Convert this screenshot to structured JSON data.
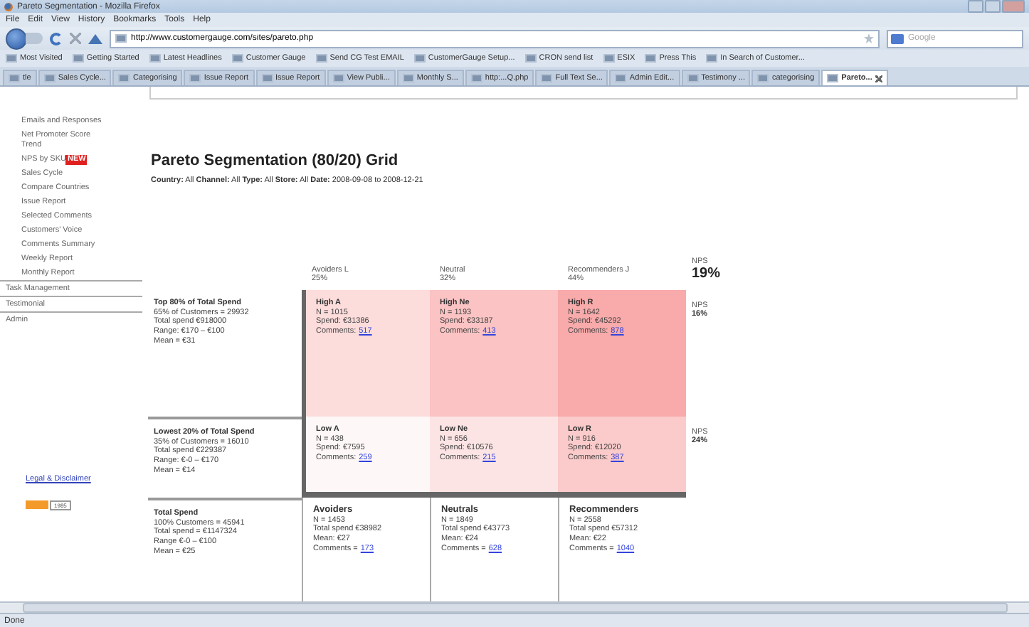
{
  "window": {
    "title": "Pareto Segmentation - Mozilla Firefox"
  },
  "menu": [
    "File",
    "Edit",
    "View",
    "History",
    "Bookmarks",
    "Tools",
    "Help"
  ],
  "address": {
    "value": "http://www.customergauge.com/sites/pareto.php"
  },
  "search": {
    "placeholder": "Google"
  },
  "bookmarks": [
    "Most Visited",
    "Getting Started",
    "Latest Headlines",
    "Customer Gauge",
    "Send CG Test EMAIL",
    "CustomerGauge Setup...",
    "CRON send list",
    "ESIX",
    "Press This",
    "In Search of Customer..."
  ],
  "tabs": [
    {
      "label": "tle",
      "selected": false
    },
    {
      "label": "Sales Cycle...",
      "selected": false
    },
    {
      "label": "Categorising",
      "selected": false
    },
    {
      "label": "Issue Report",
      "selected": false
    },
    {
      "label": "Issue Report",
      "selected": false
    },
    {
      "label": "View Publi...",
      "selected": false
    },
    {
      "label": "Monthly S...",
      "selected": false
    },
    {
      "label": "http:...Q.php",
      "selected": false
    },
    {
      "label": "Full Text Se...",
      "selected": false
    },
    {
      "label": "Admin Edit...",
      "selected": false
    },
    {
      "label": "Testimony ...",
      "selected": false
    },
    {
      "label": "categorising",
      "selected": false
    },
    {
      "label": "Pareto...",
      "selected": true
    }
  ],
  "sidebar": {
    "items": [
      {
        "label": "Emails and Responses",
        "kind": "sub"
      },
      {
        "label": "Net Promoter Score Trend",
        "kind": "sub"
      },
      {
        "label": "NPS by SKU",
        "badge": "NEW",
        "kind": "sub"
      },
      {
        "label": "Sales Cycle",
        "kind": "sub"
      },
      {
        "label": "Compare Countries",
        "kind": "sub"
      },
      {
        "label": "Issue Report",
        "kind": "sub"
      },
      {
        "label": "Selected Comments",
        "kind": "sub"
      },
      {
        "label": "Customers' Voice",
        "kind": "sub"
      },
      {
        "label": "Comments Summary",
        "kind": "sub"
      },
      {
        "label": "Weekly Report",
        "kind": "sub"
      },
      {
        "label": "Monthly Report",
        "kind": "sub"
      },
      {
        "label": "Task Management",
        "kind": "top"
      },
      {
        "label": "Testimonial",
        "kind": "top"
      },
      {
        "label": "Admin",
        "kind": "top"
      }
    ],
    "legal_link": "Legal & Disclaimer",
    "badge_text": "1985"
  },
  "page": {
    "title": "Pareto Segmentation (80/20) Grid",
    "filters": "**Country:** All **Channel:** All **Type:** All **Store:** All **Date:** 2008-09-08 to 2008-12-21"
  },
  "grid": {
    "columns": [
      {
        "label": "Avoiders L",
        "share": "25%"
      },
      {
        "label": "Neutral",
        "share": "32%"
      },
      {
        "label": "Recommenders J",
        "share": "44%"
      }
    ],
    "nps_total": {
      "label": "NPS",
      "value": "19%"
    },
    "rows": [
      {
        "segment": {
          "title": "Top 80% of Total Spend",
          "lines": [
            "65% of Customers = 29932",
            "Total spend €918000",
            "Range: €170 – €100",
            "Mean = €31"
          ]
        },
        "cells": [
          {
            "title": "High A",
            "lines": [
              "N = 1015",
              "Spend: €31386"
            ],
            "comments_label": "Comments:",
            "comments": "517",
            "color": "#fddcdc"
          },
          {
            "title": "High Ne",
            "lines": [
              "N = 1193",
              "Spend: €33187"
            ],
            "comments_label": "Comments:",
            "comments": "413",
            "color": "#fbc3c3"
          },
          {
            "title": "High R",
            "lines": [
              "N = 1642",
              "Spend: €45292"
            ],
            "comments_label": "Comments:",
            "comments": "878",
            "color": "#f9aaaa"
          }
        ],
        "nps": {
          "label": "NPS",
          "value": "16%"
        }
      },
      {
        "segment": {
          "title": "Lowest 20% of Total Spend",
          "lines": [
            "35% of Customers = 16010",
            "Total spend €229387",
            "Range: €-0 – €170",
            "Mean = €14"
          ]
        },
        "cells": [
          {
            "title": "Low A",
            "lines": [
              "N = 438",
              "Spend: €7595"
            ],
            "comments_label": "Comments:",
            "comments": "259",
            "color": "#fef7f7"
          },
          {
            "title": "Low Ne",
            "lines": [
              "N = 656",
              "Spend: €10576"
            ],
            "comments_label": "Comments:",
            "comments": "215",
            "color": "#fde4e4"
          },
          {
            "title": "Low R",
            "lines": [
              "N = 916",
              "Spend: €12020"
            ],
            "comments_label": "Comments:",
            "comments": "387",
            "color": "#fbcaca"
          }
        ],
        "nps": {
          "label": "NPS",
          "value": "24%"
        }
      }
    ],
    "totals": {
      "segment": {
        "title": "Total Spend",
        "lines": [
          "100% Customers = 45941",
          "Total spend = €1147324",
          "Range €-0 – €100",
          "Mean = €25"
        ]
      },
      "cells": [
        {
          "title": "Avoiders",
          "lines": [
            "N = 1453",
            "Total spend €38982",
            "Mean: €27"
          ],
          "comments_label": "Comments =",
          "comments": "173"
        },
        {
          "title": "Neutrals",
          "lines": [
            "N = 1849",
            "Total spend €43773",
            "Mean: €24"
          ],
          "comments_label": "Comments =",
          "comments": "628"
        },
        {
          "title": "Recommenders",
          "lines": [
            "N = 2558",
            "Total spend €57312",
            "Mean: €22"
          ],
          "comments_label": "Comments =",
          "comments": "1040"
        }
      ]
    }
  },
  "status_bar": {
    "text": "Done"
  }
}
